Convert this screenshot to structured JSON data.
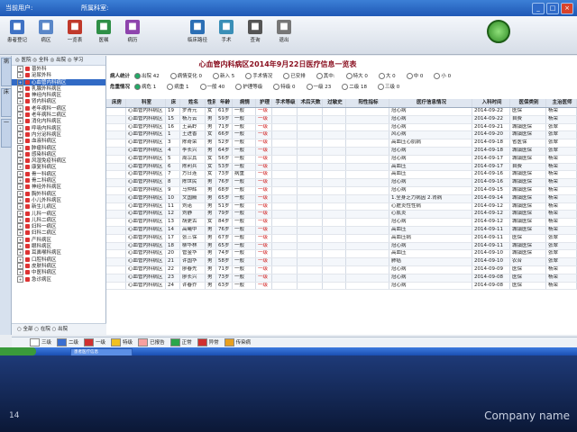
{
  "titlebar": {
    "text_left": "当前用户:",
    "text_mid": "所属科室:",
    "text_right": "",
    "min": "_",
    "max": "□",
    "close": "×"
  },
  "toolbar": [
    {
      "label": "患者登记",
      "icon": "register-icon",
      "color": "#3f72c4"
    },
    {
      "label": "病区",
      "icon": "ward-icon",
      "color": "#5a87c8"
    },
    {
      "label": "一览表",
      "icon": "overview-icon",
      "color": "#c0392b"
    },
    {
      "label": "医嘱",
      "icon": "order-icon",
      "color": "#2f8f46"
    },
    {
      "label": "病历",
      "icon": "record-icon",
      "color": "#8e44ad"
    },
    {
      "label": "临床路径",
      "icon": "pathway-icon",
      "color": "#2c6fb5"
    },
    {
      "label": "手术",
      "icon": "surgery-icon",
      "color": "#3a8fb7"
    },
    {
      "label": "查询",
      "icon": "query-icon",
      "color": "#555555"
    },
    {
      "label": "退出",
      "icon": "exit-icon",
      "color": "#777777"
    }
  ],
  "gauge": {
    "value": "",
    "lines": [
      "",
      "",
      ""
    ]
  },
  "sidetabs": [
    "病",
    "床",
    "一"
  ],
  "tree": {
    "header": "◎ 医院  ◎ 全科  ◎ 出院  ◎ 学习",
    "items": [
      "普外科",
      "泌尿外科",
      "心血管内科病区",
      "乳腺外科病区",
      "神经内科病区",
      "肾内科病区",
      "老年病科一病区",
      "老年病科二病区",
      "消化内科病区",
      "呼吸内科病区",
      "内分泌科病区",
      "血液科病区",
      "肿瘤科病区",
      "感染科病区",
      "风湿免疫科病区",
      "康复科病区",
      "骨一科病区",
      "骨二科病区",
      "神经外科病区",
      "胸外科病区",
      "小儿外科病区",
      "新生儿病区",
      "儿科一病区",
      "儿科二病区",
      "妇科一病区",
      "妇科二病区",
      "产科病区",
      "眼科病区",
      "耳鼻喉科病区",
      "口腔科病区",
      "皮肤科病区",
      "中医科病区",
      "急诊病区"
    ],
    "selected_index": 2,
    "footer": "○ 全部  ○ 在院  ○ 出院"
  },
  "page": {
    "title": "心血管内科病区2014年9月22日医疗信息一览表"
  },
  "filters": {
    "row1_label": "病人统计",
    "row1_items": [
      "出院 42",
      "病情变化 0",
      "新入 5",
      "手术情况",
      "已安排",
      "其中:",
      "特大 0",
      "大 0",
      "中 0",
      "小 0"
    ],
    "row2_label": "危重情况",
    "row2_items": [
      "病危 1",
      "病重 1",
      "一般 40",
      "护理等级",
      "特级 0",
      "一级 23",
      "二级 18",
      "三级 0"
    ]
  },
  "table": {
    "headers": [
      "床房",
      "科室",
      "床",
      "姓名",
      "性别",
      "年龄",
      "病情",
      "护理",
      "手术等级",
      "术后天数",
      "过敏史",
      "阳性指标",
      "医疗信息情况",
      "入科时间",
      "医保类别",
      "主治医师"
    ],
    "rows": [
      [
        "",
        "心血管内科病区",
        "19",
        "罗青元",
        "女",
        "61岁",
        "一般",
        "一级",
        "",
        "",
        "",
        "",
        "冠心病",
        "2014-09-22",
        "医保",
        "杨荣"
      ],
      [
        "",
        "心血管内科病区",
        "15",
        "杨万云",
        "男",
        "59岁",
        "一般",
        "一级",
        "",
        "",
        "",
        "",
        "冠心病",
        "2014-09-22",
        "自费",
        "杨荣"
      ],
      [
        "",
        "心血管内科病区",
        "16",
        "王高岭",
        "男",
        "71岁",
        "一般",
        "一级",
        "",
        "",
        "",
        "",
        "冠心病",
        "2014-09-21",
        "城镇医保",
        "张翠"
      ],
      [
        "",
        "心血管内科病区",
        "1",
        "王进香",
        "女",
        "66岁",
        "一般",
        "一级",
        "",
        "",
        "",
        "",
        "风心病",
        "2014-09-20",
        "城镇医保",
        "张翠"
      ],
      [
        "",
        "心血管内科病区",
        "3",
        "陈奇荣",
        "男",
        "52岁",
        "一般",
        "一级",
        "",
        "",
        "",
        "",
        "高血压心肌病",
        "2014-09-18",
        "省医保",
        "张翠"
      ],
      [
        "",
        "心血管内科病区",
        "4",
        "李长兴",
        "男",
        "64岁",
        "一般",
        "一级",
        "",
        "",
        "",
        "",
        "冠心病",
        "2014-09-18",
        "城镇医保",
        "张翠"
      ],
      [
        "",
        "心血管内科病区",
        "5",
        "周宗其",
        "女",
        "56岁",
        "一般",
        "一级",
        "",
        "",
        "",
        "",
        "冠心病",
        "2014-09-17",
        "城镇医保",
        "杨荣"
      ],
      [
        "",
        "心血管内科病区",
        "6",
        "陈利兵",
        "女",
        "53岁",
        "一般",
        "一级",
        "",
        "",
        "",
        "",
        "高血压",
        "2014-09-17",
        "自费",
        "杨荣"
      ],
      [
        "",
        "心血管内科病区",
        "7",
        "方日连",
        "女",
        "73岁",
        "病重",
        "一级",
        "",
        "",
        "",
        "",
        "高血压",
        "2014-09-16",
        "城镇医保",
        "杨荣"
      ],
      [
        "",
        "心血管内科病区",
        "8",
        "陈世民",
        "男",
        "76岁",
        "一般",
        "一级",
        "",
        "",
        "",
        "",
        "冠心病",
        "2014-09-16",
        "城镇医保",
        "杨荣"
      ],
      [
        "",
        "心血管内科病区",
        "9",
        "马仲辉",
        "男",
        "68岁",
        "一般",
        "一级",
        "",
        "",
        "",
        "",
        "冠心病",
        "2014-09-15",
        "城镇医保",
        "杨荣"
      ],
      [
        "",
        "心血管内科病区",
        "10",
        "文国殿",
        "男",
        "65岁",
        "一般",
        "一级",
        "",
        "",
        "",
        "",
        "1.全身乏力病因 2.肾病",
        "2014-09-14",
        "城镇医保",
        "杨荣"
      ],
      [
        "",
        "心血管内科病区",
        "11",
        "刘诺",
        "男",
        "51岁",
        "一般",
        "一级",
        "",
        "",
        "",
        "",
        "心脏炎性性病",
        "2014-09-12",
        "城镇医保",
        "杨荣"
      ],
      [
        "",
        "心血管内科病区",
        "12",
        "刘静",
        "男",
        "79岁",
        "一般",
        "一级",
        "",
        "",
        "",
        "",
        "心肌炎",
        "2014-09-12",
        "城镇医保",
        "杨荣"
      ],
      [
        "",
        "心血管内科病区",
        "13",
        "胡更古",
        "女",
        "84岁",
        "一般",
        "一级",
        "",
        "",
        "",
        "",
        "冠心病",
        "2014-09-12",
        "城镇医保",
        "杨荣"
      ],
      [
        "",
        "心血管内科病区",
        "14",
        "高曦中",
        "男",
        "76岁",
        "一般",
        "一级",
        "",
        "",
        "",
        "",
        "高血压",
        "2014-09-11",
        "城镇医保",
        "杨荣"
      ],
      [
        "",
        "心血管内科病区",
        "17",
        "张三保",
        "男",
        "67岁",
        "一般",
        "一级",
        "",
        "",
        "",
        "",
        "高血压病",
        "2014-09-11",
        "医保",
        "张翠"
      ],
      [
        "",
        "心血管内科病区",
        "18",
        "柳华林",
        "男",
        "65岁",
        "一般",
        "一级",
        "",
        "",
        "",
        "",
        "冠心病",
        "2014-09-11",
        "城镇医保",
        "张翠"
      ],
      [
        "",
        "心血管内科病区",
        "20",
        "管金华",
        "男",
        "74岁",
        "一般",
        "一级",
        "",
        "",
        "",
        "",
        "高血压",
        "2014-09-10",
        "城镇医保",
        "张翠"
      ],
      [
        "",
        "心血管内科病区",
        "21",
        "许国华",
        "男",
        "58岁",
        "一般",
        "一级",
        "",
        "",
        "",
        "",
        "肺癌",
        "2014-09-10",
        "农合",
        "张翠"
      ],
      [
        "",
        "心血管内科病区",
        "22",
        "廖春先",
        "男",
        "71岁",
        "一般",
        "一级",
        "",
        "",
        "",
        "",
        "冠心病",
        "2014-09-09",
        "医保",
        "杨荣"
      ],
      [
        "",
        "心血管内科病区",
        "23",
        "廖长兴",
        "男",
        "73岁",
        "一般",
        "一级",
        "",
        "",
        "",
        "",
        "冠心病",
        "2014-09-08",
        "医保",
        "杨荣"
      ],
      [
        "",
        "心血管内科病区",
        "24",
        "许春乔",
        "男",
        "63岁",
        "一般",
        "一级",
        "",
        "",
        "",
        "",
        "冠心病",
        "2014-09-08",
        "医保",
        "杨荣"
      ]
    ]
  },
  "legend": [
    {
      "label": "三级",
      "color": "#ffffff"
    },
    {
      "label": "二级",
      "color": "#3a6fd1"
    },
    {
      "label": "一级",
      "color": "#d03030"
    },
    {
      "label": "特级",
      "color": "#f0c020"
    },
    {
      "label": "已报告",
      "color": "#f6a0a0"
    },
    {
      "label": "正常",
      "color": "#2aa64a"
    },
    {
      "label": "异常",
      "color": "#d03030"
    },
    {
      "label": "传染病",
      "color": "#e8a020"
    }
  ],
  "taskbar": {
    "item": "患者医疗信息"
  },
  "slide": {
    "page_number": "14",
    "company": "Company name"
  }
}
